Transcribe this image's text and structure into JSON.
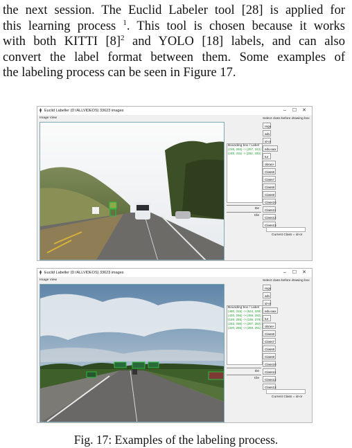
{
  "paragraph": {
    "line1": "the next session. The Euclid Labeler tool [28] is applied for",
    "line2a": "this learning process ",
    "line2_sup": "1",
    "line2b": ". This tool is chosen because it works",
    "line3a": "with both KITTI [8]",
    "line3_sup": "2",
    "line3b": " and YOLO [18] labels, and can also",
    "line4": "convert the label format between them. Some examples of",
    "line5": "the labeling process can be seen in Figure 17."
  },
  "windows": [
    {
      "title": "Euclid Labeller (D:/ALLVIDEOS) 33623 images",
      "controls": [
        "–",
        "☐",
        "✕"
      ],
      "image_view_label": "Image View",
      "select_class_label": "Select class before drawing box",
      "bbox_header": "Bounding box / Label",
      "bbox_entries": [
        "(248, 293) -> (267, 312)",
        "(248, 311) -> (262, 332)"
      ],
      "bottom_buttons": [
        "De",
        "Cle"
      ],
      "class_buttons": [
        "regu",
        "adv",
        "id-or",
        "edu-aux",
        "tur",
        "obras+",
        "Class6",
        "Class7",
        "Class8",
        "Class9",
        "Class10",
        "Class11",
        "Class12",
        "Class13"
      ],
      "current_class": "Current Class = id-or"
    },
    {
      "title": "Euclid Labeller (D:/ALLVIDEOS) 33623 images",
      "controls": [
        "–",
        "☐",
        "✕"
      ],
      "image_view_label": "Image View",
      "select_class_label": "Select class before drawing box",
      "bbox_header": "Bounding box / Label",
      "bbox_entries": [
        "(480, 315) -> (524, 339)",
        "(420, 256) -> (455, 282)",
        "(159, 255) -> (195, 278)",
        "(253, 256) -> (287, 282)",
        "(320, 256) -> (350, 281)"
      ],
      "bottom_buttons": [
        "De",
        "Cle"
      ],
      "class_buttons": [
        "regu",
        "adv",
        "id-or",
        "edu-aux",
        "tur",
        "obras+",
        "Class6",
        "Class7",
        "Class8",
        "Class9",
        "Class10",
        "Class11",
        "Class12",
        "Class13"
      ],
      "current_class": "Current Class = id-or"
    }
  ],
  "caption": "Fig. 17: Examples of the labeling process.",
  "colors": {
    "box_green": "#2dbb3c",
    "sky1": "#f2f5f7",
    "sky2": "#6c8fb0"
  }
}
